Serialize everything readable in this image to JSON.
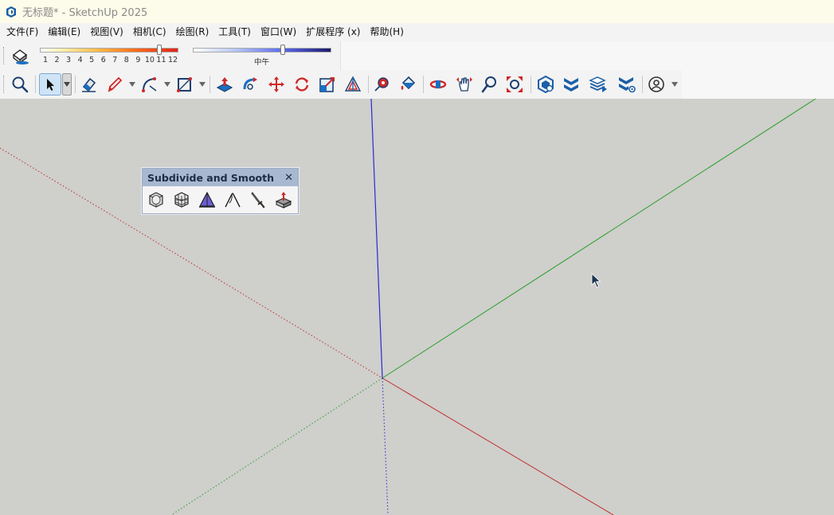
{
  "window": {
    "title": "无标题* - SketchUp 2025",
    "icon": "sketchup-logo-icon"
  },
  "menu": {
    "items": [
      "文件(F)",
      "编辑(E)",
      "视图(V)",
      "相机(C)",
      "绘图(R)",
      "工具(T)",
      "窗口(W)",
      "扩展程序 (x)",
      "帮助(H)"
    ]
  },
  "shadows": {
    "icon": "shadow-toggle-icon",
    "month_ticks": [
      "1",
      "2",
      "3",
      "4",
      "5",
      "6",
      "7",
      "8",
      "9",
      "10",
      "11",
      "12"
    ],
    "month_level": 0.86,
    "time_label": "中午",
    "time_level": 0.65
  },
  "toolbar": {
    "tools": [
      "search-icon",
      "select-icon",
      "eraser-icon",
      "pencil-icon",
      "arc-icon",
      "rectangle-icon",
      "push-pull-icon",
      "follow-me-icon",
      "move-icon",
      "rotate-icon",
      "scale-icon",
      "offset-icon",
      "tape-measure-icon",
      "paint-bucket-icon",
      "orbit-icon",
      "pan-icon",
      "zoom-icon",
      "zoom-extents-icon",
      "3d-warehouse-icon",
      "extension-warehouse-icon",
      "layout-icon",
      "extension-manager-icon",
      "account-icon"
    ],
    "selected": "select-icon"
  },
  "axes": {
    "colors": {
      "red": "#c0302a",
      "green": "#2aa02a",
      "blue": "#2b2bd0"
    }
  },
  "subdivide_panel": {
    "title": "Subdivide and Smooth",
    "close": "✕",
    "tools": [
      "subdivide-smooth-icon",
      "subdivide-mesh-icon",
      "crease-tool-icon",
      "knife-subdivide-icon",
      "sword-tool-icon",
      "artisan-settings-icon"
    ]
  },
  "colors": {
    "viewport": "#cfcfcc",
    "titlebar": "#fdfbe9",
    "accent": "#cfe4f7"
  }
}
